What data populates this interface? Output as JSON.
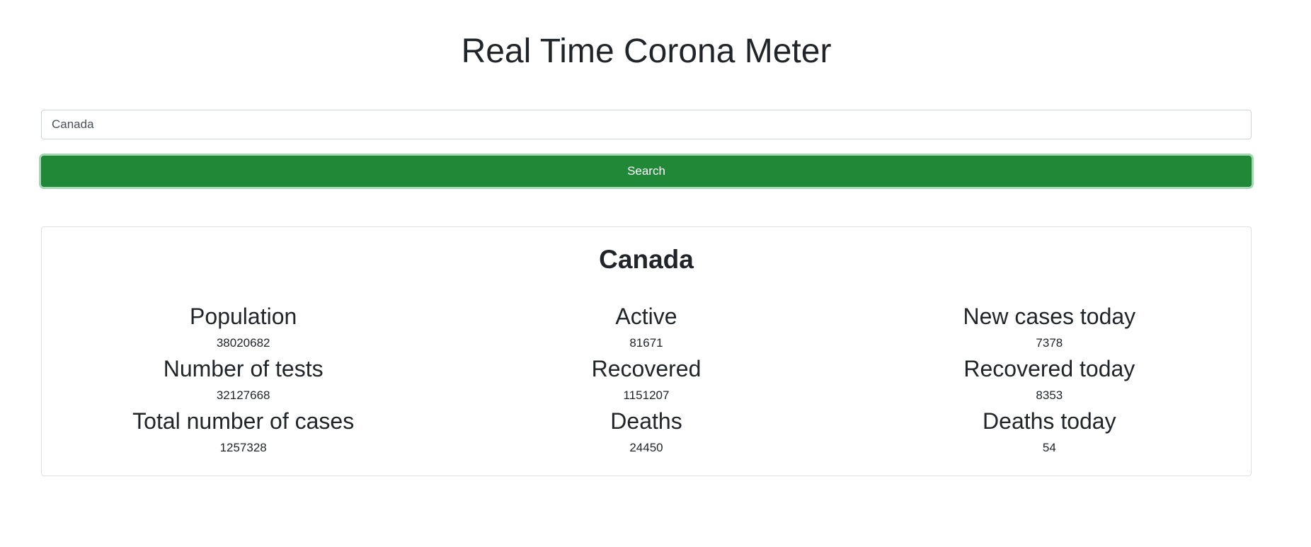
{
  "header": {
    "title": "Real Time Corona Meter"
  },
  "search": {
    "value": "Canada",
    "button_label": "Search"
  },
  "result": {
    "country": "Canada",
    "stats": [
      {
        "label": "Population",
        "value": "38020682"
      },
      {
        "label": "Active",
        "value": "81671"
      },
      {
        "label": "New cases today",
        "value": "7378"
      },
      {
        "label": "Number of tests",
        "value": "32127668"
      },
      {
        "label": "Recovered",
        "value": "1151207"
      },
      {
        "label": "Recovered today",
        "value": "8353"
      },
      {
        "label": "Total number of cases",
        "value": "1257328"
      },
      {
        "label": "Deaths",
        "value": "24450"
      },
      {
        "label": "Deaths today",
        "value": "54"
      }
    ]
  },
  "colors": {
    "button_bg": "#218838",
    "button_text": "#ffffff",
    "text": "#212529"
  }
}
